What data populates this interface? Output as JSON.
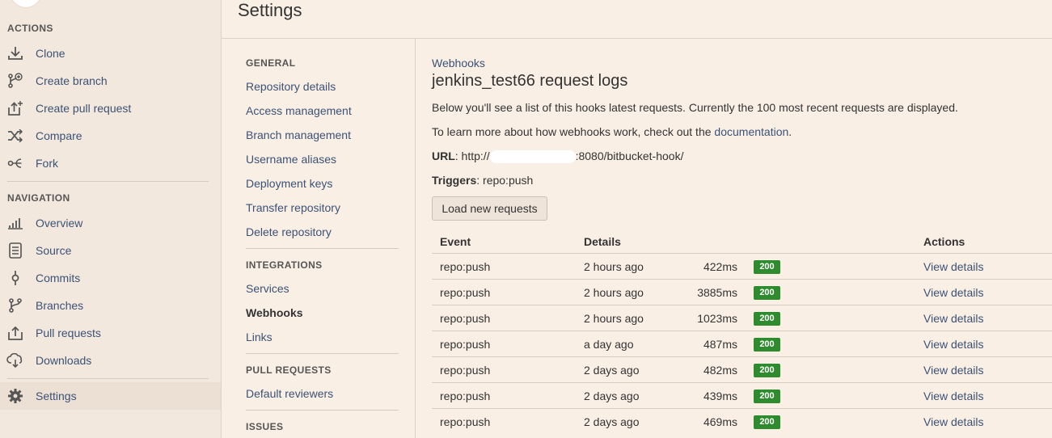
{
  "colors": {
    "background": "#f9efe5",
    "link": "#3b5275",
    "status_ok": "#2e8b2e"
  },
  "sidebar": {
    "actions_heading": "ACTIONS",
    "actions": [
      {
        "label": "Clone",
        "icon": "download-icon"
      },
      {
        "label": "Create branch",
        "icon": "branch-plus-icon"
      },
      {
        "label": "Create pull request",
        "icon": "upload-plus-icon"
      },
      {
        "label": "Compare",
        "icon": "shuffle-icon"
      },
      {
        "label": "Fork",
        "icon": "fork-icon"
      }
    ],
    "navigation_heading": "NAVIGATION",
    "navigation": [
      {
        "label": "Overview",
        "icon": "bar-chart-icon"
      },
      {
        "label": "Source",
        "icon": "document-icon"
      },
      {
        "label": "Commits",
        "icon": "commit-icon"
      },
      {
        "label": "Branches",
        "icon": "branch-icon"
      },
      {
        "label": "Pull requests",
        "icon": "pull-request-icon"
      },
      {
        "label": "Downloads",
        "icon": "cloud-download-icon"
      }
    ],
    "settings": {
      "label": "Settings",
      "icon": "gear-icon"
    }
  },
  "header": {
    "title": "Settings"
  },
  "settings_nav": {
    "general_heading": "GENERAL",
    "general": [
      "Repository details",
      "Access management",
      "Branch management",
      "Username aliases",
      "Deployment keys",
      "Transfer repository",
      "Delete repository"
    ],
    "integrations_heading": "INTEGRATIONS",
    "integrations": [
      "Services",
      "Webhooks",
      "Links"
    ],
    "pull_requests_heading": "PULL REQUESTS",
    "pull_requests": [
      "Default reviewers"
    ],
    "issues_heading": "ISSUES",
    "current": "Webhooks"
  },
  "main": {
    "breadcrumb": "Webhooks",
    "title": "jenkins_test66 request logs",
    "intro": "Below you'll see a list of this hooks latest requests. Currently the 100 most recent requests are displayed.",
    "learn_prefix": "To learn more about how webhooks work, check out the ",
    "learn_link": "documentation",
    "learn_suffix": ".",
    "url_label": "URL",
    "url_prefix": ": http://",
    "url_suffix": ":8080/bitbucket-hook/",
    "triggers_label": "Triggers",
    "triggers_value": ": repo:push",
    "load_button": "Load new requests",
    "table": {
      "headers": {
        "event": "Event",
        "details": "Details",
        "actions": "Actions"
      },
      "rows": [
        {
          "event": "repo:push",
          "time": "2 hours ago",
          "duration": "422ms",
          "status": "200",
          "action": "View details"
        },
        {
          "event": "repo:push",
          "time": "2 hours ago",
          "duration": "3885ms",
          "status": "200",
          "action": "View details"
        },
        {
          "event": "repo:push",
          "time": "2 hours ago",
          "duration": "1023ms",
          "status": "200",
          "action": "View details"
        },
        {
          "event": "repo:push",
          "time": "a day ago",
          "duration": "487ms",
          "status": "200",
          "action": "View details"
        },
        {
          "event": "repo:push",
          "time": "2 days ago",
          "duration": "482ms",
          "status": "200",
          "action": "View details"
        },
        {
          "event": "repo:push",
          "time": "2 days ago",
          "duration": "439ms",
          "status": "200",
          "action": "View details"
        },
        {
          "event": "repo:push",
          "time": "2 days ago",
          "duration": "469ms",
          "status": "200",
          "action": "View details"
        }
      ]
    }
  }
}
